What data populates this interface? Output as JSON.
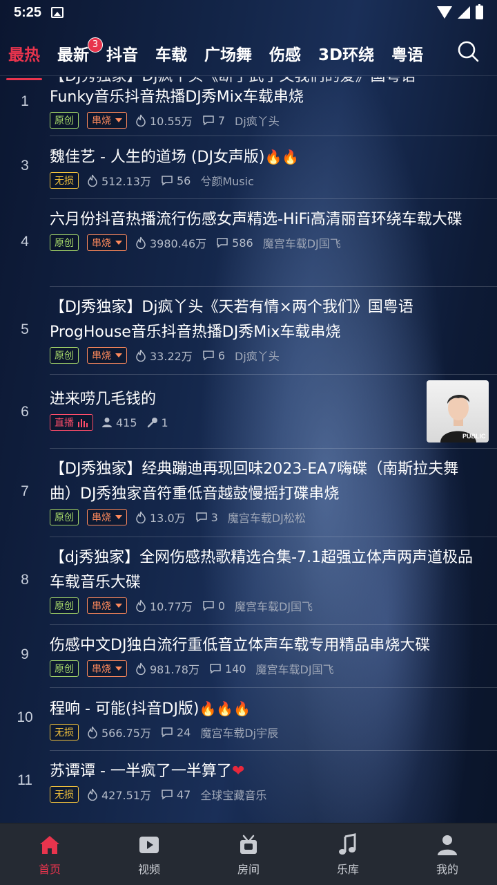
{
  "status_bar": {
    "time": "5:25"
  },
  "tabs": [
    {
      "label": "最热",
      "active": true
    },
    {
      "label": "最新",
      "badge": "3"
    },
    {
      "label": "抖音"
    },
    {
      "label": "车载"
    },
    {
      "label": "广场舞"
    },
    {
      "label": "伤感"
    },
    {
      "label": "3D环绕"
    },
    {
      "label": "粤语"
    }
  ],
  "items": [
    {
      "rank": "1",
      "title_partial": "【DJ秀独家】Dj疯丫头《断了武了又我们的爱》国粤语",
      "title": "Funky音乐抖音热播DJ秀Mix车载串烧",
      "tag1": "原创",
      "tag2": "串烧",
      "plays": "10.55万",
      "comments": "7",
      "author": "Dj疯丫头"
    },
    {
      "rank": "3",
      "title": "魏佳艺 - 人生的道场 (DJ女声版)",
      "flames": "🔥🔥",
      "tag1": "无损",
      "plays": "512.13万",
      "comments": "56",
      "author": "兮颜Music"
    },
    {
      "rank": "4",
      "title": "六月份抖音热播流行伤感女声精选-HiFi高清丽音环绕车载大碟",
      "tag1": "原创",
      "tag2": "串烧",
      "plays": "3980.46万",
      "comments": "586",
      "author": "魔宫车载DJ国飞"
    },
    {
      "rank": "5",
      "title": "【DJ秀独家】Dj疯丫头《天若有情×两个我们》国粤语ProgHouse音乐抖音热播DJ秀Mix车载串烧",
      "tag1": "原创",
      "tag2": "串烧",
      "plays": "33.22万",
      "comments": "6",
      "author": "Dj疯丫头"
    },
    {
      "rank": "6",
      "title": "进来唠几毛钱的",
      "tag1": "直播",
      "listeners": "415",
      "mics": "1",
      "thumb_label": "PUBLIC"
    },
    {
      "rank": "7",
      "title": "【DJ秀独家】经典蹦迪再现回味2023-EA7嗨碟（南斯拉夫舞曲）DJ秀独家音符重低音越鼓慢摇打碟串烧",
      "tag1": "原创",
      "tag2": "串烧",
      "plays": "13.0万",
      "comments": "3",
      "author": "魔宫车载DJ松松"
    },
    {
      "rank": "8",
      "title": "【dj秀独家】全网伤感热歌精选合集-7.1超强立体声两声道极品车载音乐大碟",
      "tag1": "原创",
      "tag2": "串烧",
      "plays": "10.77万",
      "comments": "0",
      "author": "魔宫车载DJ国飞"
    },
    {
      "rank": "9",
      "title": "伤感中文DJ独白流行重低音立体声车载专用精品串烧大碟",
      "tag1": "原创",
      "tag2": "串烧",
      "plays": "981.78万",
      "comments": "140",
      "author": "魔宫车载DJ国飞"
    },
    {
      "rank": "10",
      "title": "程响 - 可能(抖音DJ版)",
      "flames": "🔥🔥🔥",
      "tag1": "无损",
      "plays": "566.75万",
      "comments": "24",
      "author": "魔宫车载Dj宇辰"
    },
    {
      "rank": "11",
      "title": "苏谭谭 - 一半疯了一半算了",
      "heart": "❤",
      "tag1": "无损",
      "plays": "427.51万",
      "comments": "47",
      "author": "全球宝藏音乐"
    }
  ],
  "bottom_nav": [
    {
      "label": "首页",
      "active": true
    },
    {
      "label": "视频"
    },
    {
      "label": "房间"
    },
    {
      "label": "乐库"
    },
    {
      "label": "我的"
    }
  ],
  "colors": {
    "accent": "#e8344d",
    "tag_original": "#a6d86a",
    "tag_medley": "#ff8a5c",
    "tag_lossless": "#f2c23c",
    "nav_bg": "#252a33"
  }
}
